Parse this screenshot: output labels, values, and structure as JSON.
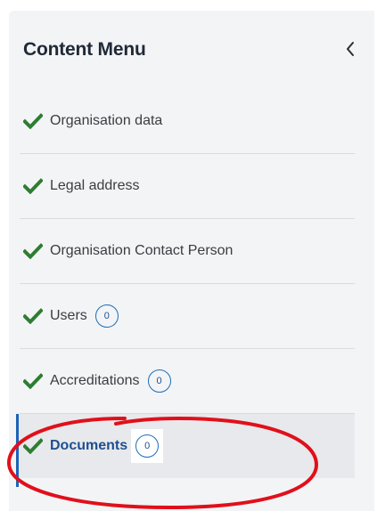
{
  "header": {
    "title": "Content Menu",
    "collapse_icon": "chevron-left-icon"
  },
  "colors": {
    "check_green": "#2e7d32",
    "active_blue": "#1d4f91",
    "badge_blue": "#1d6fb8",
    "annotation_red": "#e0101b"
  },
  "menu": {
    "items": [
      {
        "label": "Organisation data",
        "status": "complete"
      },
      {
        "label": "Legal address",
        "status": "complete"
      },
      {
        "label": "Organisation Contact Person",
        "status": "complete"
      },
      {
        "label": "Users",
        "status": "complete",
        "count": "0"
      },
      {
        "label": "Accreditations",
        "status": "complete",
        "count": "0"
      },
      {
        "label": "Documents",
        "status": "complete",
        "count": "0",
        "active": true
      }
    ]
  }
}
